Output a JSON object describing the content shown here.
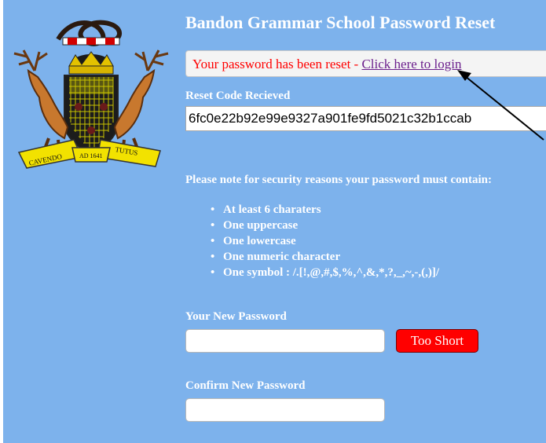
{
  "page": {
    "title": "Bandon Grammar School Password Reset",
    "crest_motto_left": "CAVENDO",
    "crest_motto_right": "TUTUS",
    "crest_year": "AD 1641"
  },
  "message": {
    "text": "Your password has been reset - ",
    "link_label": "Click here to login"
  },
  "reset_code": {
    "label": "Reset Code Recieved",
    "value": "6fc0e22b92e99e9327a901fe9fd5021c32b1ccab"
  },
  "requirements": {
    "intro": "Please note for security reasons your password must contain:",
    "items": [
      "At least 6 charaters",
      "One uppercase",
      "One lowercase",
      "One numeric character",
      "One symbol : /.[!,@,#,$,%,^,&,*,?,_,~,-,(,)]/"
    ]
  },
  "new_password": {
    "label": "Your New Password",
    "value": "",
    "strength": "Too Short"
  },
  "confirm_password": {
    "label": "Confirm New Password",
    "value": ""
  },
  "colors": {
    "background": "#7db2ec",
    "message_text": "#ff0000",
    "link": "#6b1f8c",
    "strength_badge": "#ff0000"
  }
}
